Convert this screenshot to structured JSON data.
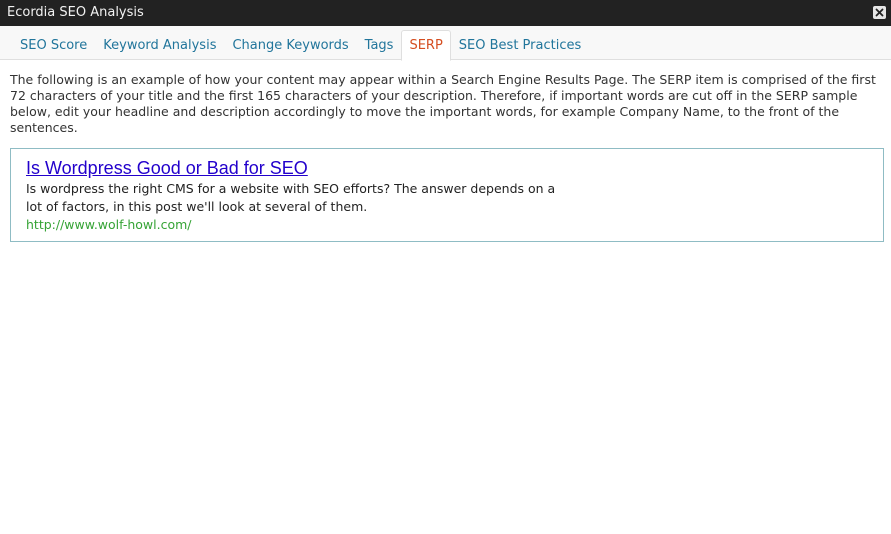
{
  "window": {
    "title": "Ecordia SEO Analysis",
    "close_icon": "close-icon"
  },
  "tabs": [
    {
      "label": "SEO Score",
      "active": false
    },
    {
      "label": "Keyword Analysis",
      "active": false
    },
    {
      "label": "Change Keywords",
      "active": false
    },
    {
      "label": "Tags",
      "active": false
    },
    {
      "label": "SERP",
      "active": true
    },
    {
      "label": "SEO Best Practices",
      "active": false
    }
  ],
  "serp_page": {
    "intro": "The following is an example of how your content may appear within a Search Engine Results Page. The SERP item is comprised of the first 72 characters of your title and the first 165 characters of your description. Therefore, if important words are cut off in the SERP sample below, edit your headline and description accordingly to move the important words, for example Company Name, to the front of the sentences.",
    "result": {
      "title": "Is Wordpress Good or Bad for SEO",
      "description": "Is wordpress the right CMS for a website with SEO efforts? The answer depends on a lot of factors, in this post we'll look at several of them.",
      "url": "http://www.wolf-howl.com/"
    }
  },
  "colors": {
    "titlebar": "#222222",
    "tab_link": "#21759b",
    "tab_active": "#d54e21",
    "serp_title": "#2200cc",
    "serp_url": "#35a335",
    "serp_border": "#8fbcc4"
  }
}
